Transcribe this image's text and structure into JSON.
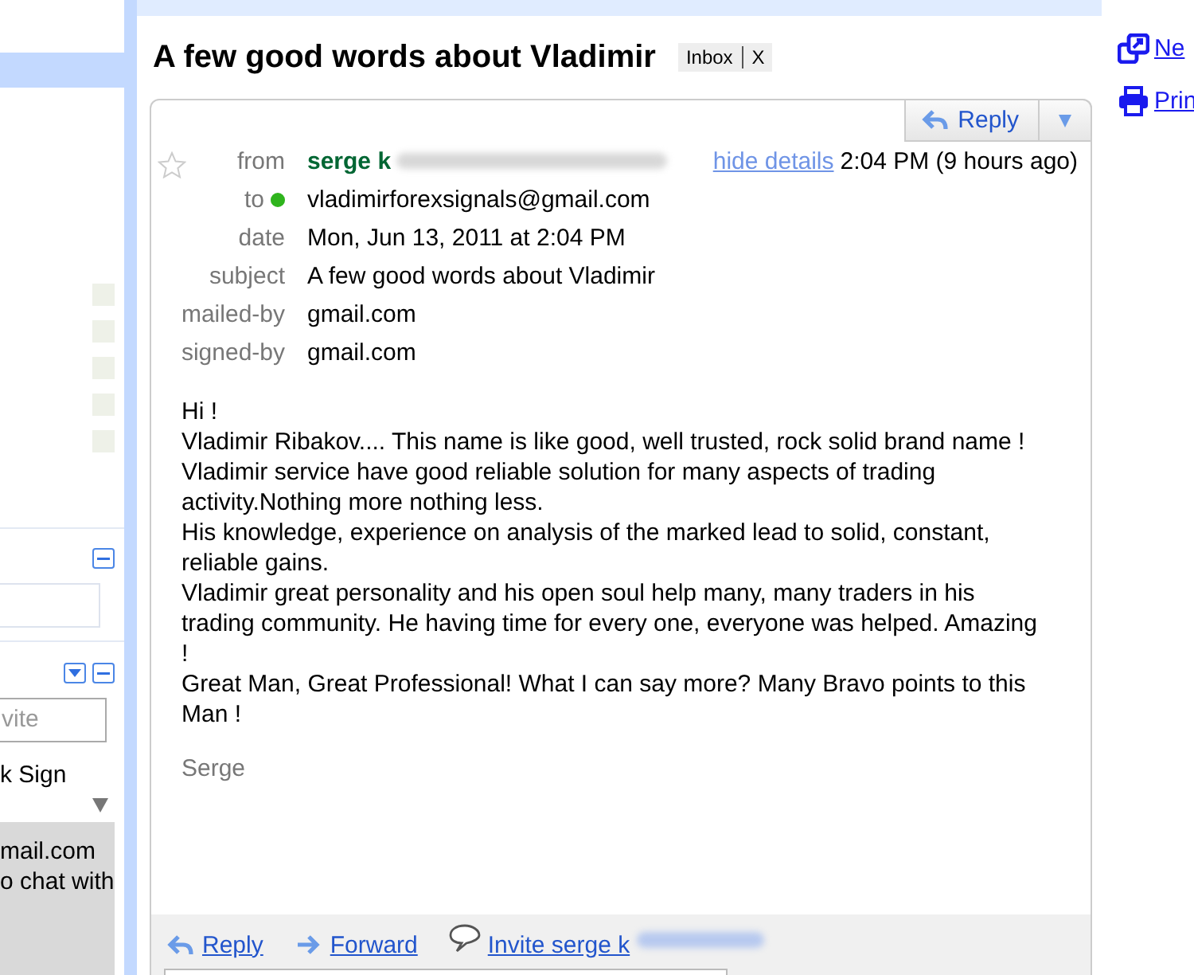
{
  "sidebar": {
    "invite_field": {
      "placeholder": "vite"
    },
    "chat_text": "k Sign",
    "chat_status_lines": [
      "mail.com",
      "o chat with"
    ]
  },
  "message": {
    "subject": "A few good words about Vladimir",
    "label": {
      "name": "Inbox",
      "remove": "X"
    },
    "starred": false,
    "reply_button": "Reply",
    "hide_details": "hide details",
    "time": "2:04 PM (9 hours ago)",
    "details": [
      {
        "kind": "sender",
        "label": "from",
        "value": "serge k"
      },
      {
        "kind": "recipient",
        "label": "to",
        "value": "vladimirforexsignals@gmail.com",
        "online": true
      },
      {
        "kind": "plain",
        "label": "date",
        "value": "Mon, Jun 13, 2011 at 2:04 PM"
      },
      {
        "kind": "plain",
        "label": "subject",
        "value": "A few good words about Vladimir"
      },
      {
        "kind": "plain",
        "label": "mailed-by",
        "value": "gmail.com"
      },
      {
        "kind": "plain",
        "label": "signed-by",
        "value": "gmail.com"
      }
    ],
    "body": [
      "Hi !",
      "Vladimir Ribakov.... This name is like good, well trusted, rock solid brand name !",
      "Vladimir service have good reliable solution for many aspects of trading",
      "activity.Nothing more nothing less.",
      "His knowledge, experience on analysis of the marked  lead to solid, constant,",
      "reliable gains.",
      "Vladimir great personality and his open soul  help many, many  traders in his",
      "trading community. He having time for every one, everyone was helped. Amazing",
      "!",
      "Great Man, Great Professional! What I can say more? Many Bravo points to this",
      "Man !"
    ],
    "signature": "Serge",
    "actions": [
      {
        "kind": "reply",
        "label": "Reply"
      },
      {
        "kind": "forward",
        "label": "Forward"
      },
      {
        "kind": "chat",
        "label": "Invite serge k"
      }
    ]
  },
  "side_links": [
    {
      "kind": "new-window",
      "label": "Ne"
    },
    {
      "kind": "print",
      "label": "Prin"
    }
  ]
}
